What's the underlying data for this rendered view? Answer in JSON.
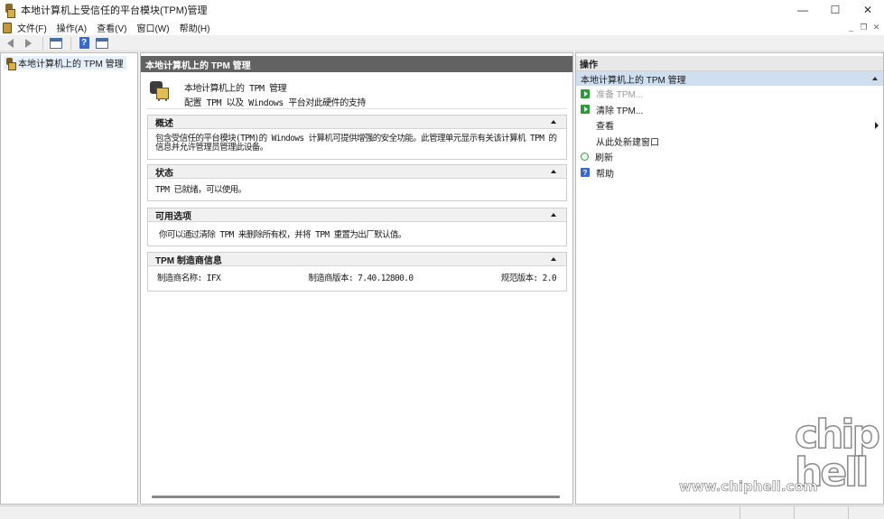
{
  "window": {
    "title": "本地计算机上受信任的平台模块(TPM)管理",
    "minimize": "—",
    "maximize": "☐",
    "close": "✕"
  },
  "menubar": {
    "items": [
      "文件(F)",
      "操作(A)",
      "查看(V)",
      "窗口(W)",
      "帮助(H)"
    ],
    "mdi_minimize": "_",
    "mdi_restore": "❐",
    "mdi_close": "✕"
  },
  "toolbar": {
    "icons": [
      "back-arrow",
      "forward-arrow",
      "show-hide-console-tree",
      "help",
      "show-hide-action-pane"
    ],
    "help_glyph": "?"
  },
  "tree": {
    "root_label": "本地计算机上的 TPM 管理"
  },
  "main": {
    "header": "本地计算机上的 TPM 管理",
    "intro_title": "本地计算机上的 TPM 管理",
    "intro_subtitle": "配置 TPM 以及 Windows 平台对此硬件的支持",
    "sections": {
      "overview": {
        "title": "概述",
        "body": "包含受信任的平台模块(TPM)的 Windows 计算机可提供增强的安全功能。此管理单元显示有关该计算机 TPM 的信息并允许管理员管理此设备。"
      },
      "status": {
        "title": "状态",
        "body": "TPM 已就绪，可以使用。"
      },
      "options": {
        "title": "可用选项",
        "body": "你可以通过清除 TPM 来删除所有权，并将 TPM 重置为出厂默认值。"
      },
      "manufacturer": {
        "title": "TPM 制造商信息",
        "name": "制造商名称: IFX",
        "version": "制造商版本: 7.40.12800.0",
        "spec": "规范版本: 2.0"
      }
    }
  },
  "actions": {
    "header": "操作",
    "group_label": "本地计算机上的 TPM 管理",
    "items": [
      {
        "label": "准备 TPM...",
        "icon": "green-action-icon",
        "enabled": false
      },
      {
        "label": "清除 TPM...",
        "icon": "green-action-icon",
        "enabled": true
      },
      {
        "label": "查看",
        "icon": "",
        "enabled": true,
        "submenu": true
      },
      {
        "label": "从此处新建窗口",
        "icon": "",
        "enabled": true
      },
      {
        "label": "刷新",
        "icon": "refresh-icon",
        "enabled": true
      },
      {
        "label": "帮助",
        "icon": "help-icon",
        "enabled": true
      }
    ],
    "help_glyph": "?"
  },
  "watermark": {
    "brand": "chip hell",
    "url": "www.chiphell.com"
  },
  "colors": {
    "pane_header": "#626262",
    "action_group": "#cfdff0",
    "tree_selection": "#e5f0fb",
    "action_icon_green": "#2f9a3a",
    "help_blue": "#3868c8"
  }
}
